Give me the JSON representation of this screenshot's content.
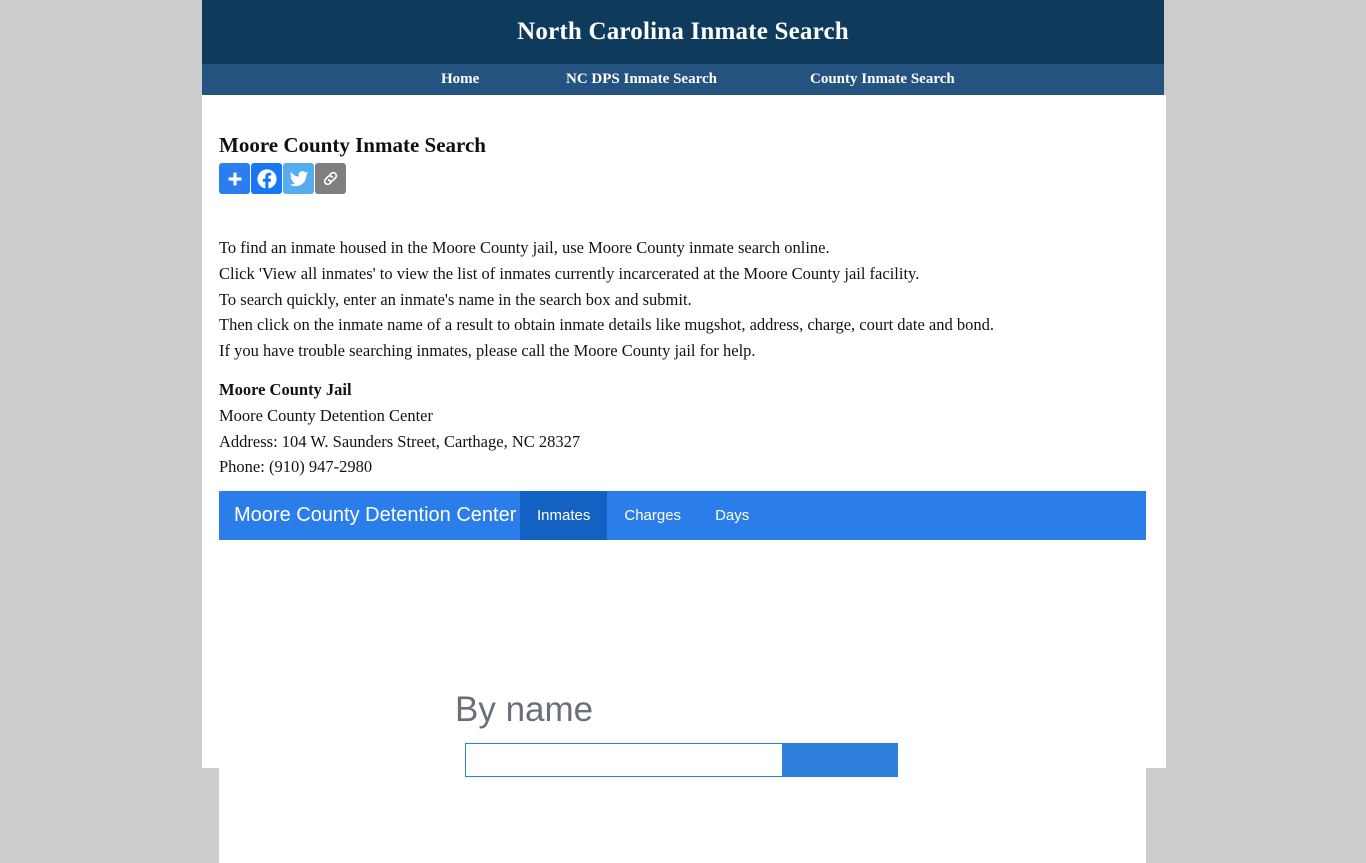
{
  "header": {
    "title": "North Carolina Inmate Search",
    "bg_color": "#0e3a5c"
  },
  "nav": {
    "bg_color": "#24537f",
    "items": [
      {
        "label": "Home"
      },
      {
        "label": "NC DPS Inmate Search"
      },
      {
        "label": "County Inmate Search"
      }
    ]
  },
  "main": {
    "page_title": "Moore County Inmate Search",
    "share": [
      {
        "name": "addthis-share-icon",
        "label": "Share",
        "color": "#2b7ef0"
      },
      {
        "name": "facebook-share-icon",
        "label": "Facebook",
        "color": "#1877f2"
      },
      {
        "name": "twitter-share-icon",
        "label": "Twitter",
        "color": "#55acee"
      },
      {
        "name": "copy-link-icon",
        "label": "Copy Link",
        "color": "#7f7f7f"
      }
    ],
    "paragraphs": [
      "To find an inmate housed in the Moore County jail, use Moore County inmate search online.",
      "Click 'View all inmates' to view the list of inmates currently incarcerated at the Moore County jail facility.",
      "To search quickly, enter an inmate's name in the search box and submit.",
      "Then click on the inmate name of a result to obtain inmate details like mugshot, address, charge, court date and bond.",
      "If you have trouble searching inmates, please call the Moore County jail for help."
    ],
    "jail": {
      "heading": "Moore County Jail",
      "facility": "Moore County Detention Center",
      "address": "Address: 104 W. Saunders Street, Carthage, NC 28327",
      "phone": "Phone: (910) 947-2980"
    }
  },
  "widget": {
    "brand": "Moore County Detention Center",
    "bar_color": "#2b7de9",
    "active_tab_color": "#1461c4",
    "tabs": [
      {
        "label": "Inmates",
        "active": true
      },
      {
        "label": "Charges",
        "active": false
      },
      {
        "label": "Days",
        "active": false
      }
    ],
    "search": {
      "heading": "By name",
      "value": "",
      "placeholder": "",
      "button_label": ""
    }
  }
}
